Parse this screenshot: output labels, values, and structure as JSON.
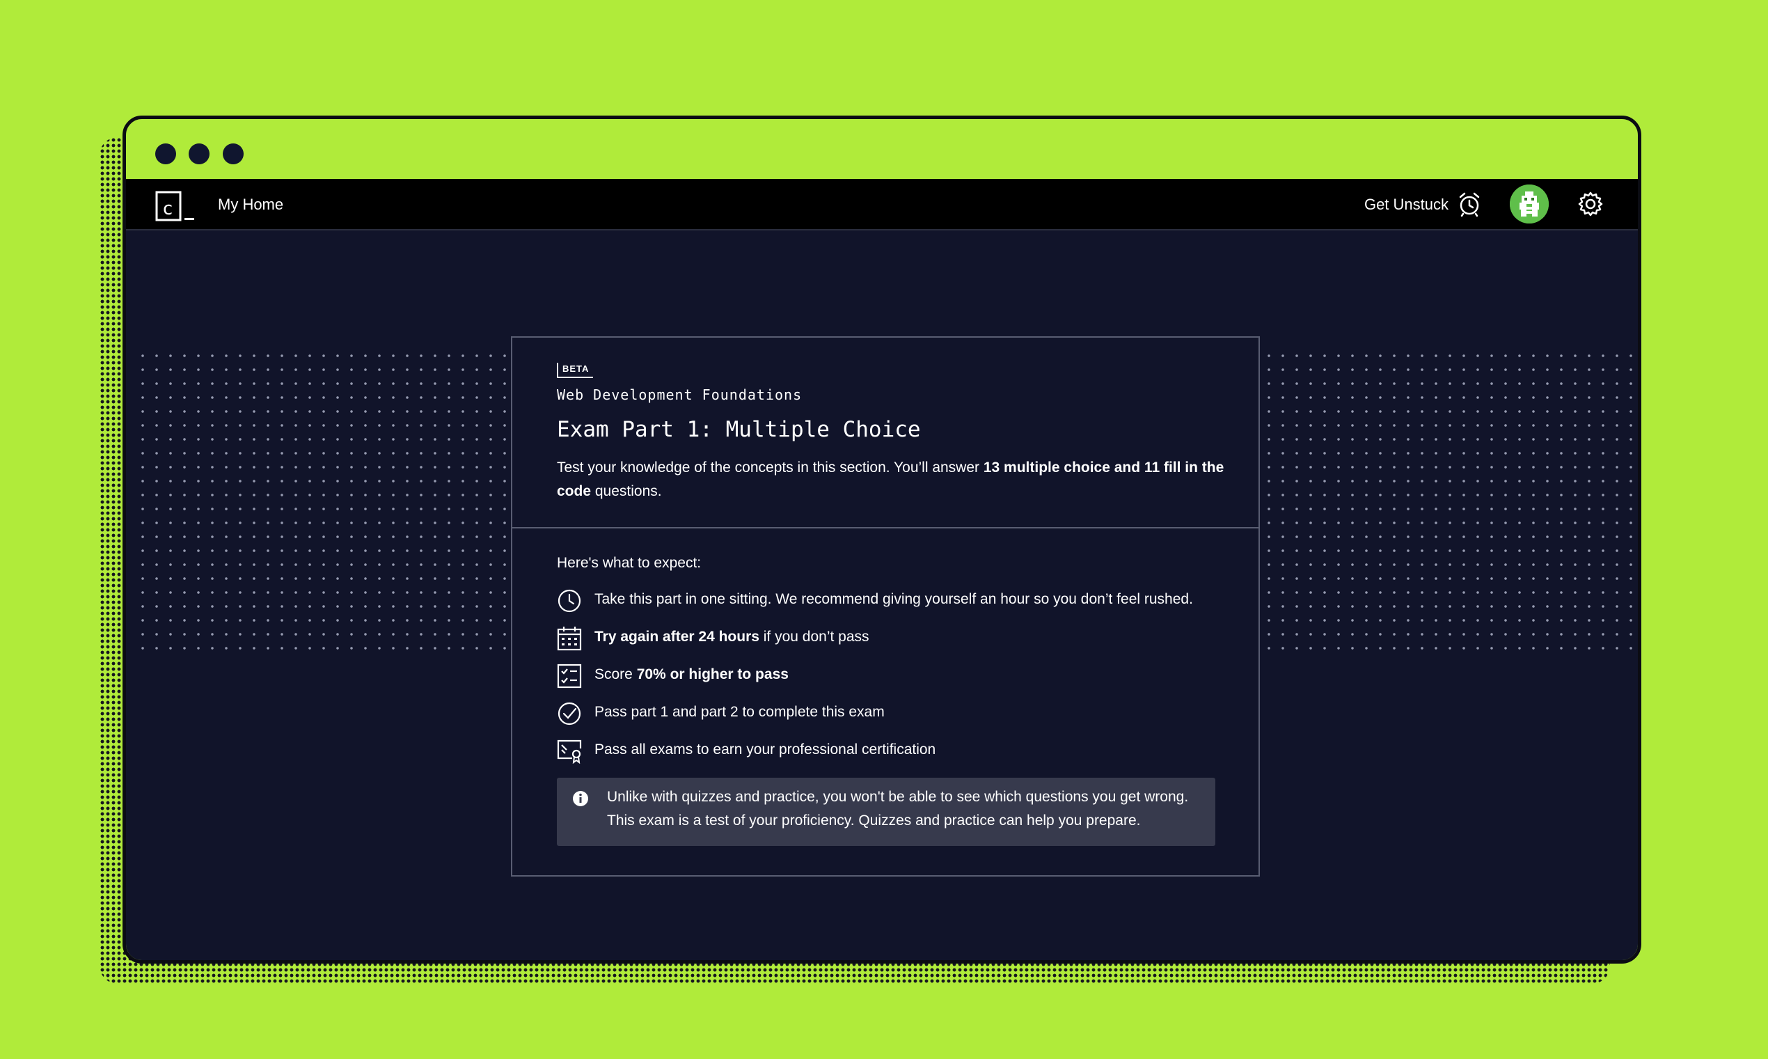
{
  "navbar": {
    "logo_letter": "c",
    "home_label": "My Home",
    "unstuck_label": "Get Unstuck"
  },
  "card": {
    "badge": "BETA",
    "course": "Web Development Foundations",
    "title": "Exam Part 1: Multiple Choice",
    "desc_prefix": "Test your knowledge of the concepts in this section. You’ll answer ",
    "desc_bold": "13 multiple choice and 11 fill in the code",
    "desc_suffix": " questions."
  },
  "expect": {
    "title": "Here's what to expect:",
    "items": [
      {
        "icon": "clock-icon",
        "bold": "",
        "text": "Take this part in one sitting. We recommend giving yourself an hour so you don’t feel rushed.",
        "pre": ""
      },
      {
        "icon": "calendar-icon",
        "bold": "Try again after 24 hours",
        "text": " if you don’t pass",
        "pre": ""
      },
      {
        "icon": "checklist-icon",
        "bold": "70% or higher to pass",
        "text": "",
        "pre": "Score "
      },
      {
        "icon": "check-circle-icon",
        "bold": "",
        "text": "Pass part 1 and part 2 to complete this exam",
        "pre": ""
      },
      {
        "icon": "certificate-icon",
        "bold": "",
        "text": "Pass all exams to earn your professional certification",
        "pre": ""
      }
    ]
  },
  "notice": {
    "icon": "info-icon",
    "line1": "Unlike with quizzes and practice, you won't be able to see which questions you get wrong.",
    "line2": "This exam is a test of your proficiency. Quizzes and practice can help you prepare."
  }
}
